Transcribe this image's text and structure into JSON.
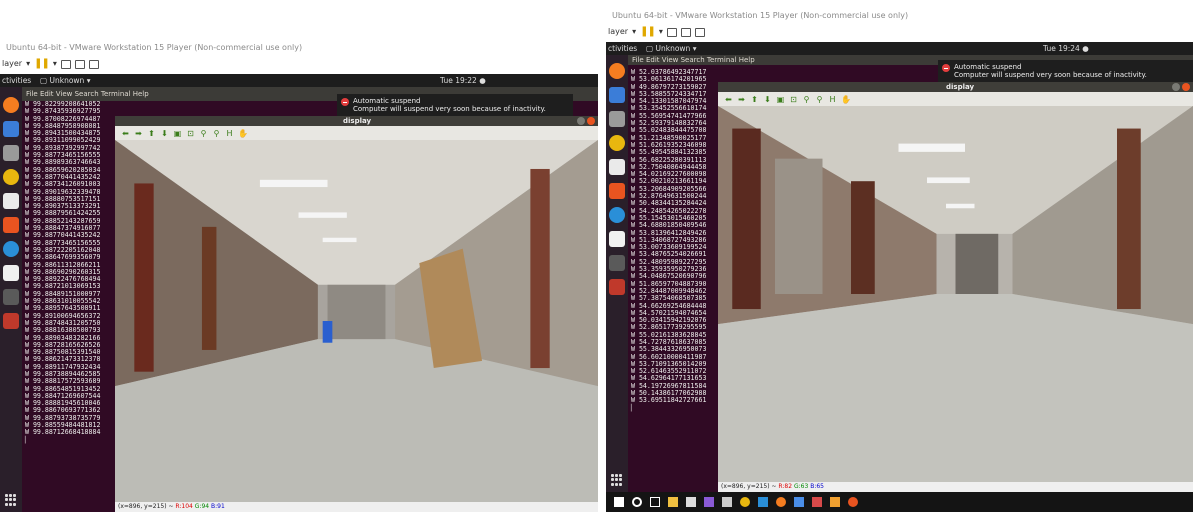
{
  "left": {
    "vm_title": "Ubuntu 64-bit - VMware Workstation 15 Player (Non-commercial use only)",
    "player_menu": "layer",
    "activities": "ctivities",
    "app_menu": "Unknown",
    "clock": "Tue 19:22",
    "terminal_menu": [
      "File",
      "Edit",
      "View",
      "Search",
      "Terminal",
      "Help"
    ],
    "notification": {
      "title": "Automatic suspend",
      "message": "Computer will suspend very soon because of inactivity."
    },
    "display_title": "display",
    "status": {
      "coords": "(x=896, y=215) ~ ",
      "r": "R:104",
      "g": "G:94",
      "b": "B:91"
    },
    "terminal_lines": [
      "W 99.82299208641052",
      "W 99.87435936927795",
      "W 99.87008226974487",
      "W 99.88487958908081",
      "W 99.89431500434875",
      "W 99.89311099052429",
      "W 99.89387392997742",
      "W 99.88773465156555",
      "W 99.88989363746643",
      "W 99.88659620285034",
      "W 99.88770441435242",
      "W 99.88734126091003",
      "W 99.89019632339478",
      "W 99.88880753517151",
      "W 99.89037513373291",
      "W 99.88879561424255",
      "W 99.88852143287659",
      "W 99.88847374916077",
      "W 99.88770441435242",
      "W 99.88773465156555",
      "W 99.88722205162048",
      "W 99.88647699356079",
      "W 99.88611312866211",
      "W 99.88690290260315",
      "W 99.88922476768494",
      "W 99.88721013069153",
      "W 99.88489151000977",
      "W 99.88631010055542",
      "W 99.88957643508911",
      "W 99.89100694656372",
      "W 99.88748431205750",
      "W 99.88816380500793",
      "W 99.88903483282166",
      "W 99.88728165626526",
      "W 99.88750815391540",
      "W 99.88621473312378",
      "W 99.88911747932434",
      "W 99.88738894462585",
      "W 99.88817572593689",
      "W 99.88654851913452",
      "W 99.88471269607544",
      "W 99.88881945610046",
      "W 99.88670693771362",
      "W 99.88793738735779",
      "W 99.88559484481812",
      "W 99.88712668418884"
    ]
  },
  "right": {
    "vm_title": "Ubuntu 64-bit - VMware Workstation 15 Player (Non-commercial use only)",
    "player_menu": "layer",
    "activities": "ctivities",
    "app_menu": "Unknown",
    "clock": "Tue 19:24",
    "terminal_menu": [
      "File",
      "Edit",
      "View",
      "Search",
      "Terminal",
      "Help"
    ],
    "notification": {
      "title": "Automatic suspend",
      "message": "Computer will suspend very soon because of inactivity."
    },
    "display_title": "display",
    "status": {
      "coords": "(x=896, y=215) ~ ",
      "r": "R:82",
      "g": "G:63",
      "b": "B:65"
    },
    "terminal_lines": [
      "W 52.03786492347717",
      "W 53.06136174201965",
      "W 49.86797273159027",
      "W 53.58855724334717",
      "W 54.13301587047974",
      "W 53.35452556610174",
      "W 55.56954741477966",
      "W 52.59379148832764",
      "W 55.02483844475708",
      "W 51.21348590025177",
      "W 51.62619352346098",
      "W 55.49545884132385",
      "W 56.68225280391113",
      "W 52.75040864944458",
      "W 54.02169227600098",
      "W 52.00210213661194",
      "W 53.20684909205566",
      "W 52.87649631500244",
      "W 50.48344135284424",
      "W 54.24854265022278",
      "W 55.15453015460205",
      "W 54.68801850409546",
      "W 53.81396412849426",
      "W 51.34068727493286",
      "W 53.00733609199524",
      "W 53.48765254026691",
      "W 52.48095989227295",
      "W 53.35935950279236",
      "W 54.04867520690796",
      "W 51.86597704887390",
      "W 52.84487009948462",
      "W 57.38754068507385",
      "W 54.66269254684448",
      "W 54.57021594074654",
      "W 50.03415942192076",
      "W 52.86517739295595",
      "W 55.02161383628845",
      "W 54.72787618637085",
      "W 55.38443326950073",
      "W 56.60210000411987",
      "W 53.71091365014209",
      "W 52.61463552911072",
      "W 54.62964177131653",
      "W 54.19726967811584",
      "W 50.14386177062988",
      "W 53.69511842727661"
    ]
  },
  "colors": {
    "terminal_bg": "#300a24",
    "topbar_bg": "#1d1d1d",
    "dock_bg": "#2a1f2a",
    "close_button": "#e95420",
    "notification_icon": "#e23d3d"
  },
  "display_toolbar_icons": [
    "arrow-left-icon",
    "arrow-right-icon",
    "arrow-up-icon",
    "arrow-down-icon",
    "save-icon",
    "properties-icon",
    "zoom-in-icon",
    "zoom-out-icon",
    "home-icon",
    "pan-icon"
  ],
  "windows_taskbar_icons": [
    "windows-start-icon",
    "search-icon",
    "task-view-icon",
    "file-explorer-icon",
    "mail-icon",
    "visual-studio-icon",
    "settings-icon",
    "chrome-icon",
    "edge-icon",
    "firefox-icon",
    "store-icon",
    "snip-icon",
    "paint-icon",
    "ubuntu-icon"
  ]
}
